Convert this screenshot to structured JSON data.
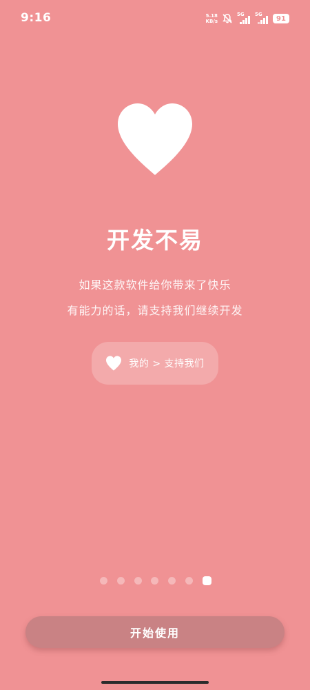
{
  "status_bar": {
    "time": "9:16",
    "net_speed_value": "5.18",
    "net_speed_unit": "KB/s",
    "signal_1_label": "5G",
    "signal_2_label": "5G",
    "battery": "91",
    "icons": [
      "mute-bell-icon",
      "signal-icon",
      "signal-icon",
      "battery-icon"
    ]
  },
  "main": {
    "icon": "heart-icon",
    "title": "开发不易",
    "description_line_1": "如果这款软件给你带来了快乐",
    "description_line_2": "有能力的话，请支持我们继续开发",
    "hint": {
      "icon": "heart-icon",
      "text": "我的 > 支持我们"
    }
  },
  "pager": {
    "total": 7,
    "current": 7
  },
  "start_button": {
    "label": "开始使用"
  },
  "colors": {
    "background": "#F09294",
    "button": "#C98284",
    "foreground": "#FFFFFF"
  }
}
